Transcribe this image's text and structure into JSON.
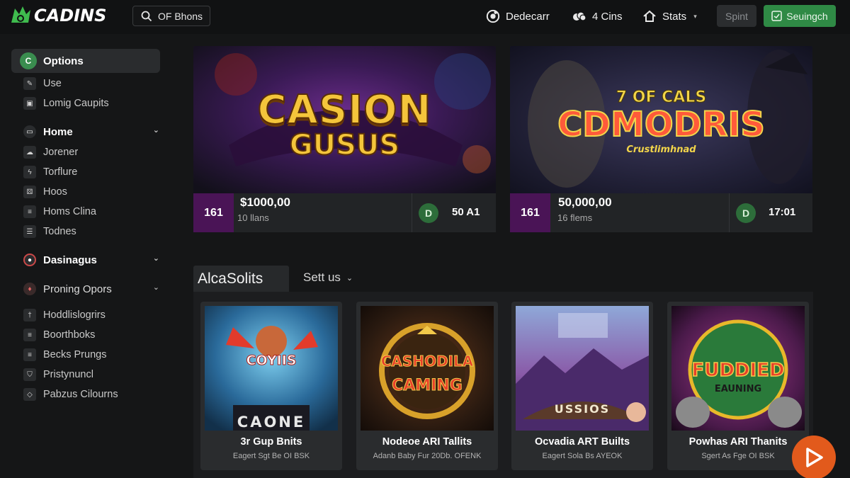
{
  "header": {
    "logo_text": "CADINS",
    "search_text": "OF Bhons",
    "items": [
      {
        "label": "Dedecarr",
        "icon": "chip-icon"
      },
      {
        "label": "4 Cins",
        "icon": "coins-icon"
      },
      {
        "label": "Stats",
        "icon": "home-icon"
      }
    ],
    "spint_label": "Spint",
    "signin_label": "Seuingch"
  },
  "sidebar": {
    "top": {
      "label": "Options",
      "icon_letter": "C"
    },
    "items_a": [
      "Use",
      "Lomig Caupits"
    ],
    "sections": [
      "Home",
      "Dasinagus",
      "Proning Opors"
    ],
    "items_b": [
      "Jorener",
      "Torflure",
      "Hoos",
      "Homs Clina",
      "Todnes"
    ],
    "items_c": [
      "Hoddlislogrirs",
      "Boorthboks",
      "Becks Prungs",
      "Pristynuncl",
      "Pabzus Cilourns"
    ]
  },
  "banners": [
    {
      "art_line1": "CASION",
      "art_line2": "GUSUS",
      "badge": "161",
      "prize": "$1000,00",
      "prize_sub": "10 llans",
      "d_letter": "D",
      "d_value": "50 A1"
    },
    {
      "art_line0": "7 OF CALS",
      "art_line1": "CDMODRIS",
      "art_line2": "Crustlimhnad",
      "badge": "161",
      "prize": "50,000,00",
      "prize_sub": "16 flems",
      "d_letter": "D",
      "d_value": "17:01"
    }
  ],
  "section": {
    "title": "AlcaSolits",
    "sort_label": "Sett us"
  },
  "cards": [
    {
      "title": "3r Gup Bnits",
      "sub": "Eagert Sgt Be OI BSK",
      "art_a": "COYIIS",
      "art_b": "CAONE"
    },
    {
      "title": "Nodeoe ARI Tallits",
      "sub": "Adanb Baby Fur 20Db. OFENK",
      "art_a": "CASHODILA",
      "art_b": "CAMING"
    },
    {
      "title": "Ocvadia ART Builts",
      "sub": "Eagert Sola Bs AYEOK",
      "art_a": "USSIOS",
      "art_b": ""
    },
    {
      "title": "Powhas ARI Thanits",
      "sub": "Sgert As Fge OI BSK",
      "art_a": "FUDDIED",
      "art_b": "EAUNING"
    }
  ]
}
